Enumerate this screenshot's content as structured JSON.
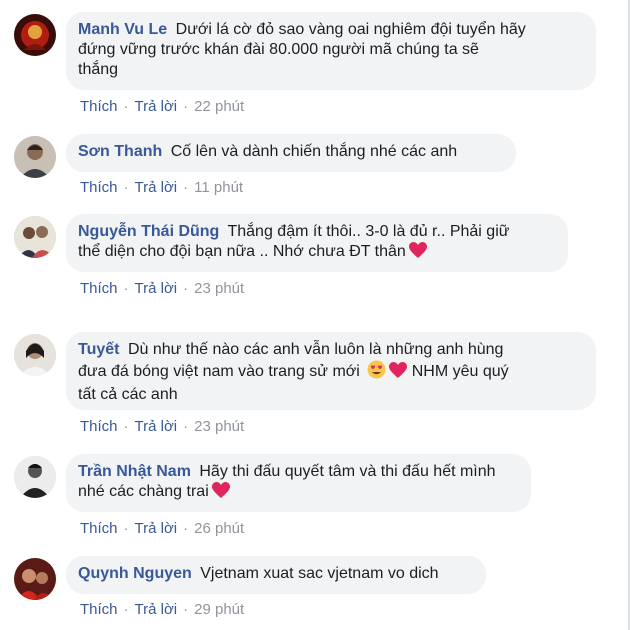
{
  "actions": {
    "like": "Thích",
    "reply": "Trả lời",
    "separator": "·"
  },
  "colors": {
    "author": "#385898",
    "bubble": "#f2f3f5",
    "meta": "#90949c",
    "heart": "#e0245e"
  },
  "comments": [
    {
      "author": "Manh Vu Le",
      "lines": [
        "Dưới lá cờ đỏ sao vàng oai nghiêm đội tuyển hãy",
        "đứng vững trước khán đài 80.000 người mã chúng ta sẽ",
        "thắng"
      ],
      "time": "22 phút"
    },
    {
      "author": "Sơn Thanh",
      "lines": [
        "Cố lên và dành chiến thắng nhé các anh"
      ],
      "time": "11 phút"
    },
    {
      "author": "Nguyễn Thái Dũng",
      "lines": [
        "Thắng đậm ít thôi.. 3-0 là đủ r.. Phải giữ",
        "thể diện cho đội bạn nữa .. Nhớ chưa ĐT thân"
      ],
      "time": "23 phút"
    },
    {
      "author": "Tuyết",
      "lines": [
        "Dù như thế nào các anh vẫn luôn là những anh hùng",
        "đưa đá bóng việt nam vào trang sử mới",
        "NHM yêu quý",
        "tất cả các anh"
      ],
      "time": "23 phút"
    },
    {
      "author": "Trần Nhật Nam",
      "lines": [
        "Hãy thi đấu quyết tâm và thi đấu hết mình",
        "nhé các chàng trai"
      ],
      "time": "26 phút"
    },
    {
      "author": "Quynh Nguyen",
      "lines": [
        "Vjetnam xuat sac vjetnam vo dich"
      ],
      "time": "29 phút"
    }
  ]
}
